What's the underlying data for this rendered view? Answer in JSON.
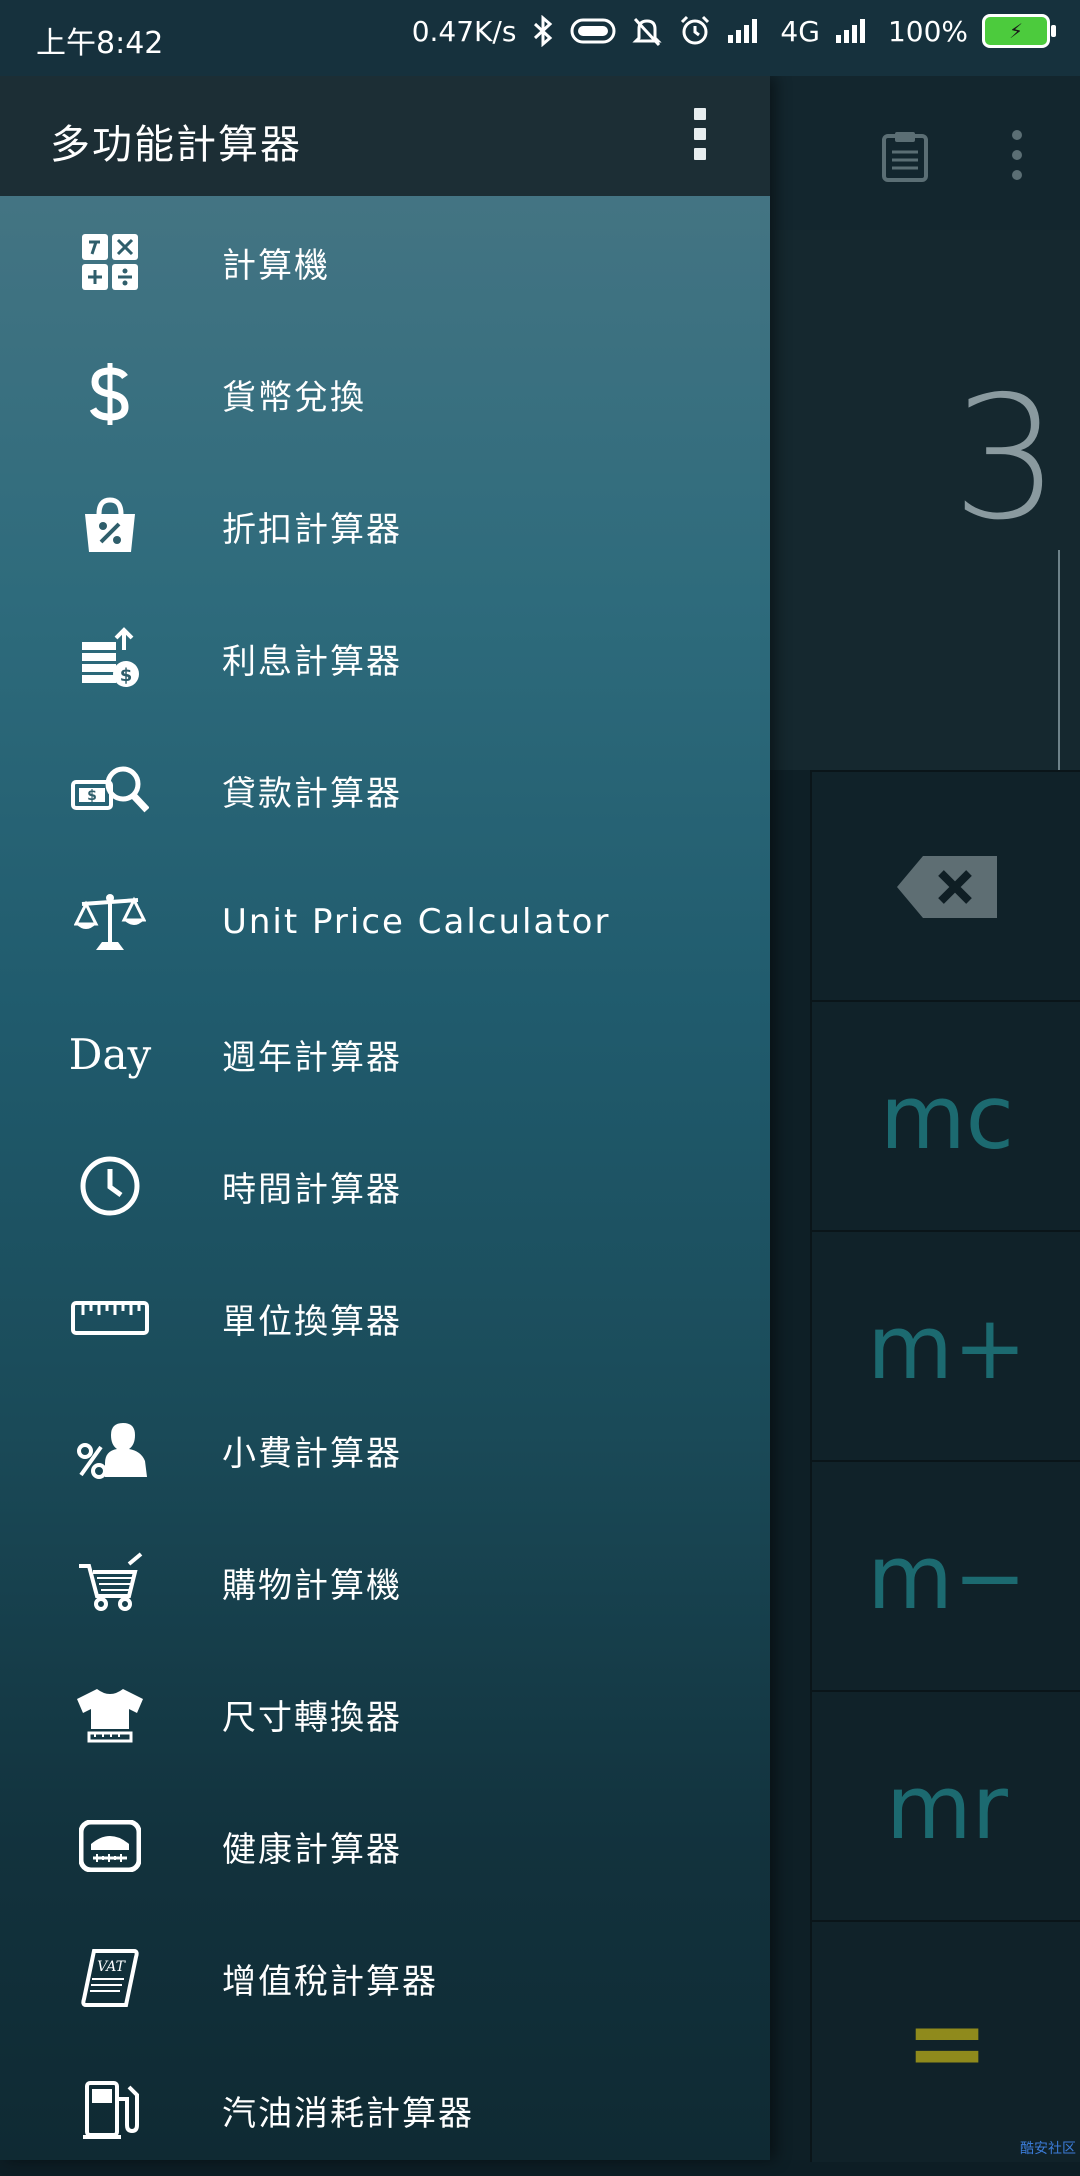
{
  "status_bar": {
    "time": "上午8:42",
    "network_speed": "0.47K/s",
    "network_type": "4G",
    "battery": "100%"
  },
  "drawer": {
    "title": "多功能計算器",
    "items": [
      {
        "label": "計算機",
        "icon": "calculator-icon"
      },
      {
        "label": "貨幣兌換",
        "icon": "dollar-icon"
      },
      {
        "label": "折扣計算器",
        "icon": "discount-bag-icon"
      },
      {
        "label": "利息計算器",
        "icon": "interest-coins-icon"
      },
      {
        "label": "貸款計算器",
        "icon": "loan-search-icon"
      },
      {
        "label": "Unit Price Calculator",
        "icon": "scale-icon"
      },
      {
        "label": "週年計算器",
        "icon": "day-text-icon"
      },
      {
        "label": "時間計算器",
        "icon": "clock-icon"
      },
      {
        "label": "單位換算器",
        "icon": "ruler-icon"
      },
      {
        "label": "小費計算器",
        "icon": "tip-person-icon"
      },
      {
        "label": "購物計算機",
        "icon": "shopping-cart-icon"
      },
      {
        "label": "尺寸轉換器",
        "icon": "tshirt-icon"
      },
      {
        "label": "健康計算器",
        "icon": "weight-scale-icon"
      },
      {
        "label": "增值稅計算器",
        "icon": "vat-scroll-icon"
      },
      {
        "label": "汽油消耗計算器",
        "icon": "fuel-pump-icon"
      }
    ],
    "day_icon_text": "Day"
  },
  "calculator": {
    "display_value": "3",
    "keys": [
      "mc",
      "m+",
      "m−",
      "mr",
      "="
    ]
  },
  "watermark": "酷安社区"
}
